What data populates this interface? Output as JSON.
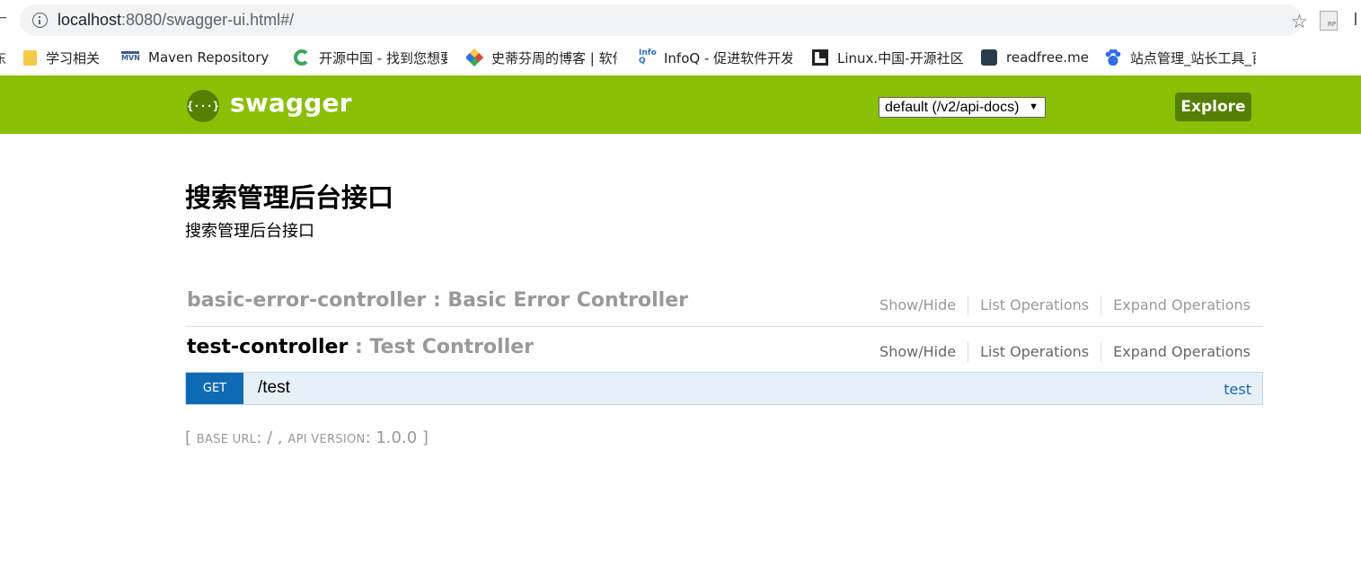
{
  "browser": {
    "url_host": "localhost",
    "url_rest": ":8080/swagger-ui.html#/",
    "bookmarks": [
      {
        "label": "学习相关",
        "icon": "folder-icon",
        "color": "#f7c948"
      },
      {
        "label": "Maven Repository:",
        "icon": "maven-icon",
        "color": "#3a5a8c"
      },
      {
        "label": "开源中国 - 找到您想要",
        "icon": "oschina-icon",
        "color": "#3aa757"
      },
      {
        "label": "史蒂芬周的博客 | 软件",
        "icon": "blog-icon",
        "color": "#d24b2b"
      },
      {
        "label": "InfoQ - 促进软件开发",
        "icon": "infoq-icon",
        "color": "#2f6fb3"
      },
      {
        "label": "Linux.中国-开源社区",
        "icon": "linux-cn-icon",
        "color": "#222222"
      },
      {
        "label": "readfree.me",
        "icon": "readfree-icon",
        "color": "#2a3b4c"
      },
      {
        "label": "站点管理_站长工具_百",
        "icon": "baidu-icon",
        "color": "#2f6ee6"
      }
    ]
  },
  "header": {
    "logo_glyph": "{···}",
    "title": "swagger",
    "api_select_value": "default (/v2/api-docs)",
    "explore_label": "Explore",
    "colors": {
      "bar": "#89bf04",
      "dark": "#547f00"
    }
  },
  "info": {
    "title": "搜索管理后台接口",
    "description": "搜索管理后台接口"
  },
  "resources": [
    {
      "name": "basic-error-controller",
      "separator": " : ",
      "description": "Basic Error Controller",
      "ops": [
        "Show/Hide",
        "List Operations",
        "Expand Operations"
      ]
    },
    {
      "name": "test-controller",
      "separator": " : ",
      "description": "Test Controller",
      "ops": [
        "Show/Hide",
        "List Operations",
        "Expand Operations"
      ]
    }
  ],
  "operation": {
    "method": "GET",
    "path": "/test",
    "summary": "test",
    "method_color": "#0f6ab4"
  },
  "footer": {
    "open": "[ ",
    "base_url_label": "BASE URL",
    "base_url_value": ": / , ",
    "api_version_label": "API VERSION",
    "api_version_value": ": 1.0.0 ",
    "close": "]"
  }
}
